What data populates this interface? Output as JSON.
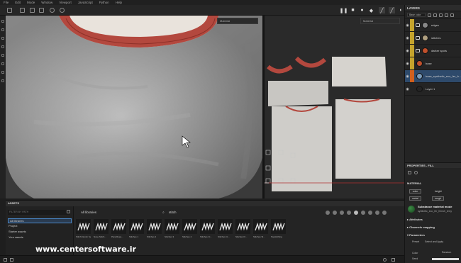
{
  "menu": [
    "File",
    "Edit",
    "Mode",
    "Window",
    "Viewport",
    "JavaScript",
    "Python",
    "Help"
  ],
  "viewport3d": {
    "mode_label": "Material"
  },
  "viewport2d": {
    "mode_label": "Material"
  },
  "layers_panel": {
    "title": "LAYERS",
    "channel_select": "Base color",
    "layers": [
      {
        "name": "edges",
        "color": "#c4a32c",
        "thumb": "#888888",
        "type": "folder"
      },
      {
        "name": "stitches",
        "color": "#c4a32c",
        "thumb": "#b0a080",
        "type": "folder"
      },
      {
        "name": "darker spots",
        "color": "#c4a32c",
        "thumb": "#c0502c",
        "type": "folder"
      },
      {
        "name": "base",
        "color": "#c4a32c",
        "thumb": "#c0502c",
        "type": "fill"
      },
      {
        "name": "base_synthetic_eco_fer_fr...",
        "color": "#d0601e",
        "thumb": "#7a9ab8",
        "type": "fill",
        "selected": true
      },
      {
        "name": "Layer 1",
        "color": "#242424",
        "thumb": "#242424",
        "type": "paint"
      }
    ]
  },
  "properties": {
    "title": "PROPERTIES - FILL",
    "material_label": "MATERIAL",
    "channels": [
      "color",
      "height",
      "metal",
      "rough"
    ],
    "material_mode_title": "Substance material mode",
    "material_mode_sub": "synthetic_eco_fer_french_terry",
    "attributes_label": "Attributes",
    "channels_mapping_label": "Channels mapping",
    "parameters_label": "Parameters",
    "preset_label": "Preset",
    "preset_value": "Select and Apply",
    "color_label": "Color",
    "random_label": "Random",
    "seed_label": "Seed"
  },
  "assets": {
    "title": "ASSETS",
    "filter_placeholder": "FILTER BY PATH",
    "tree": [
      "All libraries",
      "Project",
      "Starter assets",
      "Your assets"
    ],
    "library_title": "All libraries",
    "search_value": "stitch",
    "items": [
      "Stitch Denim Sett...",
      "Nose Stitch...",
      "Para Rope...",
      "Stitches 1",
      "Stitches 2",
      "Stitches 3",
      "Stitches 4",
      "Stitches Ci...",
      "Stitches Ci...",
      "Stitches Fl...",
      "Stitches Sl...",
      "Topstitching"
    ]
  },
  "watermark": "www.centersoftware.ir"
}
